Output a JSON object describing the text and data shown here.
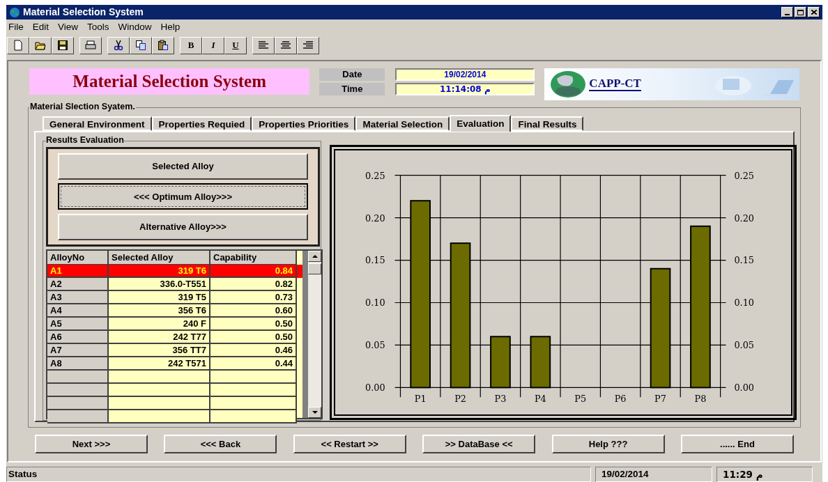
{
  "window": {
    "title": "Material Selection System"
  },
  "menu": [
    "File",
    "Edit",
    "View",
    "Tools",
    "Window",
    "Help"
  ],
  "toolbar": [
    {
      "kind": "new"
    },
    {
      "kind": "open"
    },
    {
      "kind": "save"
    },
    {
      "kind": "gap"
    },
    {
      "kind": "print"
    },
    {
      "kind": "gap"
    },
    {
      "kind": "cut"
    },
    {
      "kind": "copy"
    },
    {
      "kind": "paste"
    },
    {
      "kind": "gap"
    },
    {
      "kind": "bold",
      "label": "B"
    },
    {
      "kind": "italic",
      "label": "I"
    },
    {
      "kind": "underline",
      "label": "U"
    },
    {
      "kind": "gap"
    },
    {
      "kind": "align-left"
    },
    {
      "kind": "align-center"
    },
    {
      "kind": "align-right"
    }
  ],
  "header": {
    "title": "Material Selection System",
    "date_label": "Date",
    "date": "19/02/2014",
    "time_label": "Time",
    "time": "11:14:08 م",
    "logo": "CAPP-CT"
  },
  "group_title": "Material Slection Syatem.",
  "tabs": [
    {
      "label": "General Environment",
      "selected": false
    },
    {
      "label": "Properties Requied",
      "selected": false
    },
    {
      "label": "Properties Priorities",
      "selected": false
    },
    {
      "label": "Material Selection",
      "selected": false
    },
    {
      "label": "Evaluation",
      "selected": true
    },
    {
      "label": "Final Results",
      "selected": false
    }
  ],
  "evaluation": {
    "title": "Results Evaluation",
    "buttons": [
      {
        "label": "Selected Alloy",
        "focused": false
      },
      {
        "label": "<<< Optimum Alloy>>>",
        "focused": true
      },
      {
        "label": "Alternative Alloy>>>",
        "focused": false
      }
    ],
    "table": {
      "columns": [
        "AlloyNo",
        "Selected Alloy",
        "Capability"
      ],
      "rows": [
        {
          "id": "A1",
          "alloy": "319 T6",
          "capability": "0.84",
          "selected": true
        },
        {
          "id": "A2",
          "alloy": "336.0-T551",
          "capability": "0.82",
          "selected": false
        },
        {
          "id": "A3",
          "alloy": "319 T5",
          "capability": "0.73",
          "selected": false
        },
        {
          "id": "A4",
          "alloy": "356 T6",
          "capability": "0.60",
          "selected": false
        },
        {
          "id": "A5",
          "alloy": "240 F",
          "capability": "0.50",
          "selected": false
        },
        {
          "id": "A6",
          "alloy": "242 T77",
          "capability": "0.50",
          "selected": false
        },
        {
          "id": "A7",
          "alloy": "356 TT7",
          "capability": "0.46",
          "selected": false
        },
        {
          "id": "A8",
          "alloy": "242 T571",
          "capability": "0.44",
          "selected": false
        }
      ]
    },
    "chart_data": {
      "type": "bar",
      "categories": [
        "P1",
        "P2",
        "P3",
        "P4",
        "P5",
        "P6",
        "P7",
        "P8"
      ],
      "grid": true,
      "series": [
        {
          "color": "#6b6b00",
          "values": [
            0.22,
            0.17,
            0.06,
            0.06,
            0,
            0,
            0.14,
            0.19
          ]
        }
      ],
      "ylim": [
        0,
        0.25
      ],
      "yticks": [
        {
          "value": 0,
          "label": "0.00"
        },
        {
          "value": 0.05,
          "label": "0.05"
        },
        {
          "value": 0.1,
          "label": "0.10"
        },
        {
          "value": 0.15,
          "label": "0.15"
        },
        {
          "value": 0.2,
          "label": "0.20"
        },
        {
          "value": 0.25,
          "label": "0.25"
        }
      ]
    }
  },
  "nav_buttons": [
    "Next >>>",
    "<<< Back",
    "<< Restart >>",
    ">> DataBase <<",
    "Help ???",
    "...... End"
  ],
  "status_bar": {
    "text": "Status",
    "date": "19/02/2014",
    "time": "11:29 م"
  }
}
